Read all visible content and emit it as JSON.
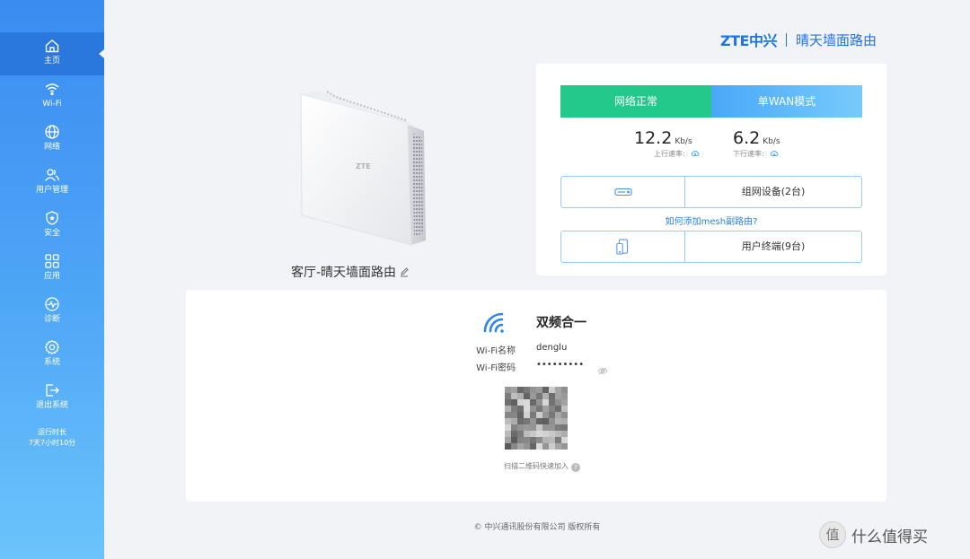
{
  "sidebar": {
    "items": [
      {
        "label": "主页",
        "icon": "home-icon",
        "active": true
      },
      {
        "label": "Wi-Fi",
        "icon": "wifi-icon"
      },
      {
        "label": "网络",
        "icon": "globe-icon"
      },
      {
        "label": "用户管理",
        "icon": "users-icon"
      },
      {
        "label": "安全",
        "icon": "shield-icon"
      },
      {
        "label": "应用",
        "icon": "apps-icon"
      },
      {
        "label": "诊断",
        "icon": "pulse-icon"
      },
      {
        "label": "系统",
        "icon": "gear-icon"
      },
      {
        "label": "退出系统",
        "icon": "logout-icon"
      }
    ],
    "uptime_label": "运行时长",
    "uptime_value": "7天7小时10分"
  },
  "brand": {
    "logo": "ZTE中兴",
    "product": "晴天墙面路由"
  },
  "device": {
    "name": "客厅-晴天墙面路由",
    "logo": "ZTE"
  },
  "status": {
    "network": "网络正常",
    "mode": "单WAN模式",
    "upload": {
      "value": "12.2",
      "unit": "Kb/s",
      "label": "上行速率:"
    },
    "download": {
      "value": "6.2",
      "unit": "Kb/s",
      "label": "下行速率:"
    },
    "mesh_devices": "组网设备(2台)",
    "mesh_link": "如何添加mesh副路由?",
    "user_terminals": "用户终端(9台)"
  },
  "wifi": {
    "title": "双频合一",
    "name_label": "Wi-Fi名称",
    "name_value": "denglu",
    "password_label": "Wi-Fi密码",
    "password_value": "•••••••••",
    "qr_hint": "扫描二维码快速加入"
  },
  "footer": "© 中兴通讯股份有限公司 版权所有",
  "watermark": {
    "badge": "值",
    "text": "什么值得买"
  },
  "colors": {
    "sidebar_top": "#3a8cf0",
    "sidebar_bottom": "#6cc4fb",
    "network_ok": "#22c98b",
    "mode_blue": "#4aa8f7",
    "brand": "#1e73e6"
  }
}
